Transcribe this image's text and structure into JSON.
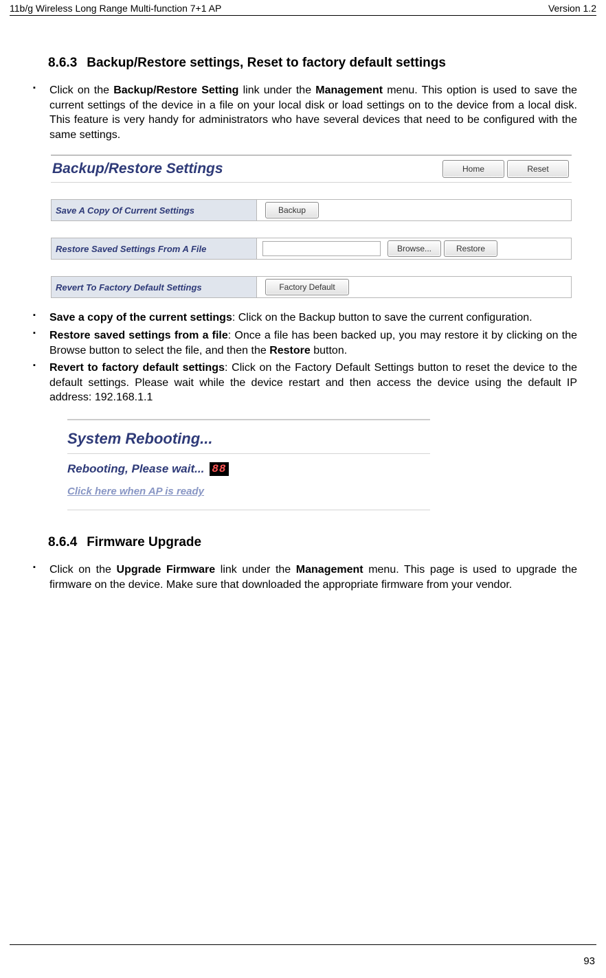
{
  "header": {
    "left": "11b/g Wireless Long Range Multi-function 7+1 AP",
    "right": "Version 1.2"
  },
  "section_863": {
    "num": "8.6.3",
    "title": "Backup/Restore settings, Reset to factory default settings"
  },
  "intro": {
    "t1": "Click on the ",
    "b1": "Backup/Restore Setting",
    "t2": " link under the ",
    "b2": "Management",
    "t3": " menu. This option is used to save the current settings of the device in a file on your local disk or load settings on to the device from a local disk. This feature is very handy for administrators who have several devices that need to be configured with the same settings."
  },
  "panel": {
    "title": "Backup/Restore Settings",
    "home": "Home",
    "reset": "Reset",
    "row1_label": "Save A Copy Of Current Settings",
    "row1_btn": "Backup",
    "row2_label": "Restore Saved Settings From A File",
    "row2_browse": "Browse...",
    "row2_restore": "Restore",
    "row3_label": "Revert To Factory Default Settings",
    "row3_btn": "Factory Default"
  },
  "bullets": {
    "b1_bold": "Save a copy of the current settings",
    "b1_rest": ": Click on the Backup button to save the current configuration.",
    "b2_bold": "Restore saved settings from a file",
    "b2_mid": ": Once a file has been backed up, you may restore it by clicking on the Browse button to select the file, and then the ",
    "b2_bold2": "Restore",
    "b2_end": " button.",
    "b3_bold": "Revert to factory default settings",
    "b3_rest": ": Click on the Factory Default Settings button to reset the device to the default settings. Please wait while the device restart and then access the device using the default IP address: 192.168.1.1"
  },
  "reboot": {
    "title": "System Rebooting...",
    "msg": "Rebooting, Please wait...",
    "count": "88",
    "link": "Click here when AP is ready"
  },
  "section_864": {
    "num": "8.6.4",
    "title": "Firmware Upgrade"
  },
  "fw": {
    "t1": "Click on the ",
    "b1": "Upgrade Firmware",
    "t2": " link under the ",
    "b2": "Management",
    "t3": " menu. This page is used to upgrade the firmware on the device. Make sure that downloaded the appropriate firmware from your vendor."
  },
  "page_number": "93"
}
